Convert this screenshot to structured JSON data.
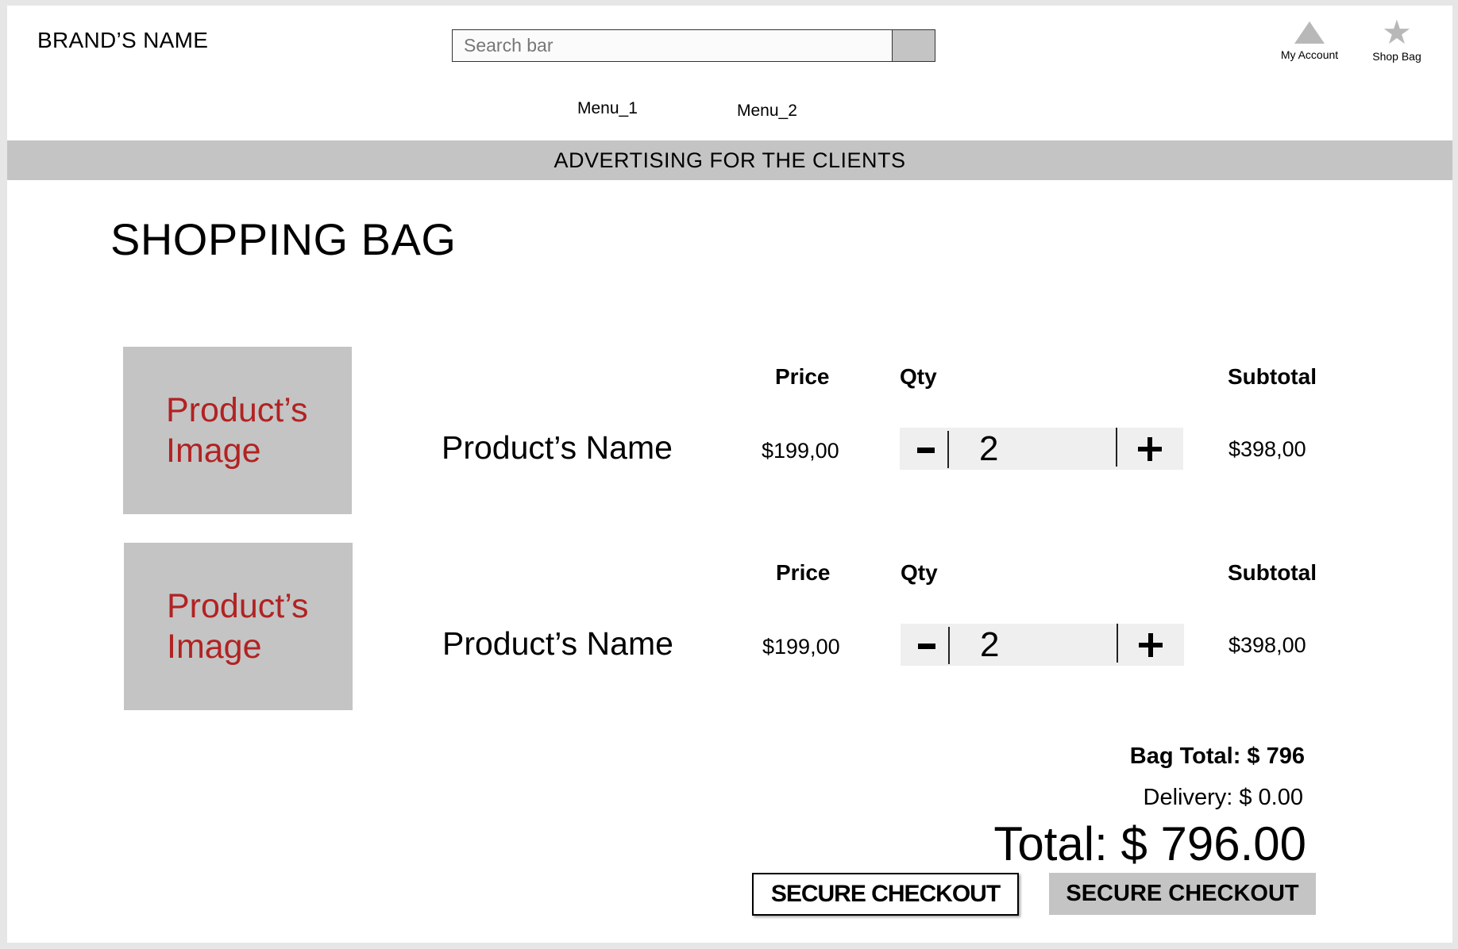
{
  "header": {
    "brand": "BRAND’S NAME",
    "search": {
      "placeholder": "Search bar",
      "value": ""
    },
    "account_label": "My Account",
    "bag_label": "Shop Bag",
    "menu": [
      "Menu_1",
      "Menu_2"
    ]
  },
  "ad_banner": "ADVERTISING FOR THE CLIENTS",
  "page_title": "SHOPPING BAG",
  "items": [
    {
      "image_label": "Product’s\nImage",
      "name": "Product’s Name",
      "price_header": "Price",
      "qty_header": "Qty",
      "subtotal_header": "Subtotal",
      "price": "$199,00",
      "qty": "2",
      "subtotal": "$398,00"
    },
    {
      "image_label": "Product’s\nImage",
      "name": "Product’s Name",
      "price_header": "Price",
      "qty_header": "Qty",
      "subtotal_header": "Subtotal",
      "price": "$199,00",
      "qty": "2",
      "subtotal": "$398,00"
    }
  ],
  "totals": {
    "bag_total": "Bag Total: $ 796",
    "delivery": "Delivery: $ 0.00",
    "total": "Total: $ 796.00"
  },
  "checkout_buttons": [
    "SECURE CHECKOUT",
    "SECURE CHECKOUT"
  ],
  "colors": {
    "banner_gray": "#c4c4c4",
    "image_label_red": "#b22222",
    "qty_bg": "#efefef"
  },
  "icons": {
    "account": "triangle-icon",
    "bag": "star-icon"
  }
}
